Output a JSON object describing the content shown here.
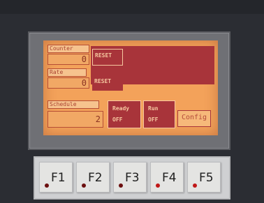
{
  "screen": {
    "fields": [
      {
        "label": "Counter",
        "value": "0",
        "button": "RESET"
      },
      {
        "label": "Rate",
        "value": "0",
        "button": "RESET"
      }
    ],
    "bottom_label": "Schedule",
    "bottom_value": "2",
    "toggle_buttons": [
      {
        "title": "Ready",
        "state": "OFF"
      },
      {
        "title": "Run",
        "state": "OFF"
      }
    ],
    "config_label": "Config"
  },
  "function_keys": [
    {
      "label": "F1",
      "led_color": "#6b0f0f"
    },
    {
      "label": "F2",
      "led_color": "#6b0f0f"
    },
    {
      "label": "F3",
      "led_color": "#6b0f0f"
    },
    {
      "label": "F4",
      "led_color": "#c01818"
    },
    {
      "label": "F5",
      "led_color": "#c01818"
    }
  ],
  "colors": {
    "screen_bg": "#f3a25a",
    "accent_red": "#a8343a"
  }
}
